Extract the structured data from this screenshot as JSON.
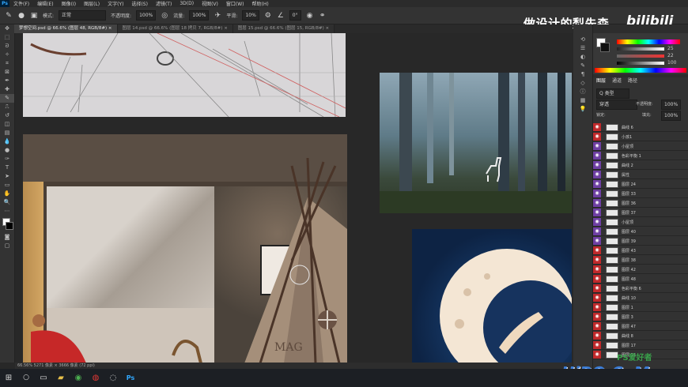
{
  "app": {
    "logo": "Ps"
  },
  "menu": [
    "文件(F)",
    "编辑(E)",
    "图像(I)",
    "图层(L)",
    "文字(Y)",
    "选择(S)",
    "滤镜(T)",
    "3D(D)",
    "视图(V)",
    "窗口(W)",
    "帮助(H)"
  ],
  "options": {
    "mode_label": "模式:",
    "mode_value": "正常",
    "opacity_label": "不透明度:",
    "opacity_value": "100%",
    "flow_label": "流量:",
    "flow_value": "100%",
    "smooth_label": "平滑:",
    "smooth_value": "10%",
    "angle_value": "0°"
  },
  "watermark_top": {
    "text": "做设计的梨先森",
    "brand": "bilibili"
  },
  "tabs": [
    {
      "label": "梦想空间.psd @ 66.6% (图层 48, RGB/8#) ×",
      "active": true
    },
    {
      "label": "图层 14.psd @ 66.6% (图层 18 拷贝 7, RGB/8#) ×",
      "active": false
    },
    {
      "label": "图层 15.psd @ 66.6% (图层 15, RGB/8#) ×",
      "active": false
    }
  ],
  "status": {
    "text": "66.56%    5271 像素 × 3666 像素 (72 ppi)"
  },
  "canvas": {
    "tent_text": "MAG"
  },
  "layers_panel": {
    "tabs": [
      "图层",
      "通道",
      "路径"
    ],
    "filter_label": "Q 类型",
    "blend_mode": "穿透",
    "opacity_label": "不透明度:",
    "opacity_value": "100%",
    "lock_label": "锁定:",
    "fill_label": "填充:",
    "fill_value": "100%",
    "rows": [
      {
        "name": "曲线 6",
        "color": "#c0292b"
      },
      {
        "name": "小孩1",
        "color": "#c0292b"
      },
      {
        "name": "小屋顶",
        "color": "#6e3fa3"
      },
      {
        "name": "色彩平衡 1",
        "color": "#6e3fa3"
      },
      {
        "name": "曲线 2",
        "color": "#6e3fa3"
      },
      {
        "name": "属性",
        "color": "#6e3fa3"
      },
      {
        "name": "图层 24",
        "color": "#6e3fa3"
      },
      {
        "name": "图层 33",
        "color": "#6e3fa3"
      },
      {
        "name": "图层 36",
        "color": "#6e3fa3"
      },
      {
        "name": "图层 37",
        "color": "#6e3fa3"
      },
      {
        "name": "小屋顶",
        "color": "#6e3fa3"
      },
      {
        "name": "图层 40",
        "color": "#6e3fa3"
      },
      {
        "name": "图层 39",
        "color": "#6e3fa3"
      },
      {
        "name": "图层 43",
        "color": "#c0292b"
      },
      {
        "name": "图层 38",
        "color": "#c0292b"
      },
      {
        "name": "图层 42",
        "color": "#c0292b"
      },
      {
        "name": "图层 48",
        "color": "#c0292b"
      },
      {
        "name": "色彩平衡 6",
        "color": "#c0292b"
      },
      {
        "name": "曲线 10",
        "color": "#c0292b"
      },
      {
        "name": "图层 1",
        "color": "#c0292b"
      },
      {
        "name": "图层 3",
        "color": "#c0292b"
      },
      {
        "name": "图层 47",
        "color": "#c0292b"
      },
      {
        "name": "曲线 8",
        "color": "#c0292b"
      },
      {
        "name": "图层 17",
        "color": "#c0292b"
      },
      {
        "name": "图层 16",
        "color": "#c0292b"
      }
    ]
  },
  "color_panel": {
    "values": [
      "25",
      "22",
      "100"
    ]
  },
  "watermark_bottom": {
    "brand": "UiBQ.CoM",
    "small": "PS爱好者"
  },
  "taskbar": [
    "windows-icon",
    "search-icon",
    "task-view-icon",
    "file-explorer-icon",
    "chrome-icon",
    "netease-icon",
    "qq-icon",
    "photoshop-icon"
  ]
}
